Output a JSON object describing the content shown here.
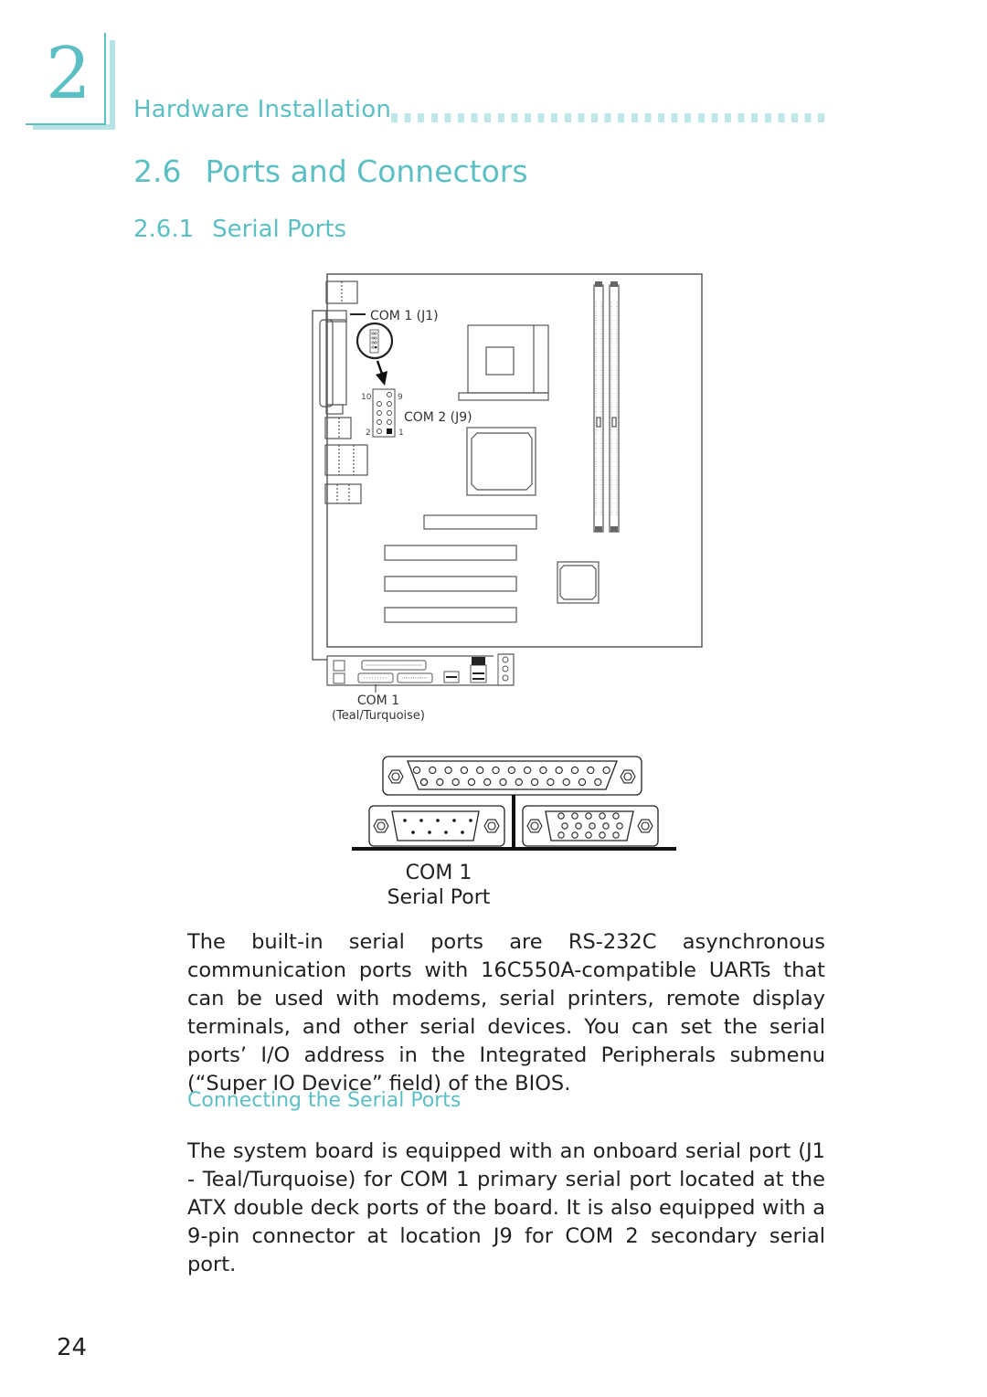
{
  "chapter": {
    "number": "2",
    "title": "Hardware Installation"
  },
  "section": {
    "number": "2.6",
    "title": "Ports and Connectors",
    "full": "2.6  Ports and Connectors"
  },
  "subsection": {
    "number": "2.6.1",
    "title": "Serial Ports",
    "full": "2.6.1  Serial Ports"
  },
  "diagram": {
    "labels": {
      "com1_header": "COM 1 (J1)",
      "com2_header": "COM 2 (J9)",
      "pin_10": "10",
      "pin_9": "9",
      "pin_2": "2",
      "pin_1": "1",
      "com1_port": "COM 1",
      "com1_color": "(Teal/Turquoise)"
    }
  },
  "ports_figure": {
    "caption_line1": "COM 1",
    "caption_line2": "Serial Port"
  },
  "paragraphs": [
    "The built-in serial ports are RS-232C asynchronous communication ports with 16C550A-compatible UARTs that can be used with modems, serial printers, remote display terminals, and other serial devices. You can set the serial ports’ I/O address in the Integrated Peripherals submenu (“Super IO Device” field) of the BIOS.",
    "The system board is equipped with an onboard serial port  (J1 - Teal/Turquoise) for COM 1 primary serial port located at the ATX double deck ports of the board. It is also equipped with a 9-pin connector at location J9 for COM 2 secondary serial port."
  ],
  "subheading": "Connecting the Serial Ports",
  "page_number": "24",
  "colors": {
    "accent": "#5bbfc4",
    "accent_light": "#b8e3e6",
    "text": "#231f20"
  }
}
